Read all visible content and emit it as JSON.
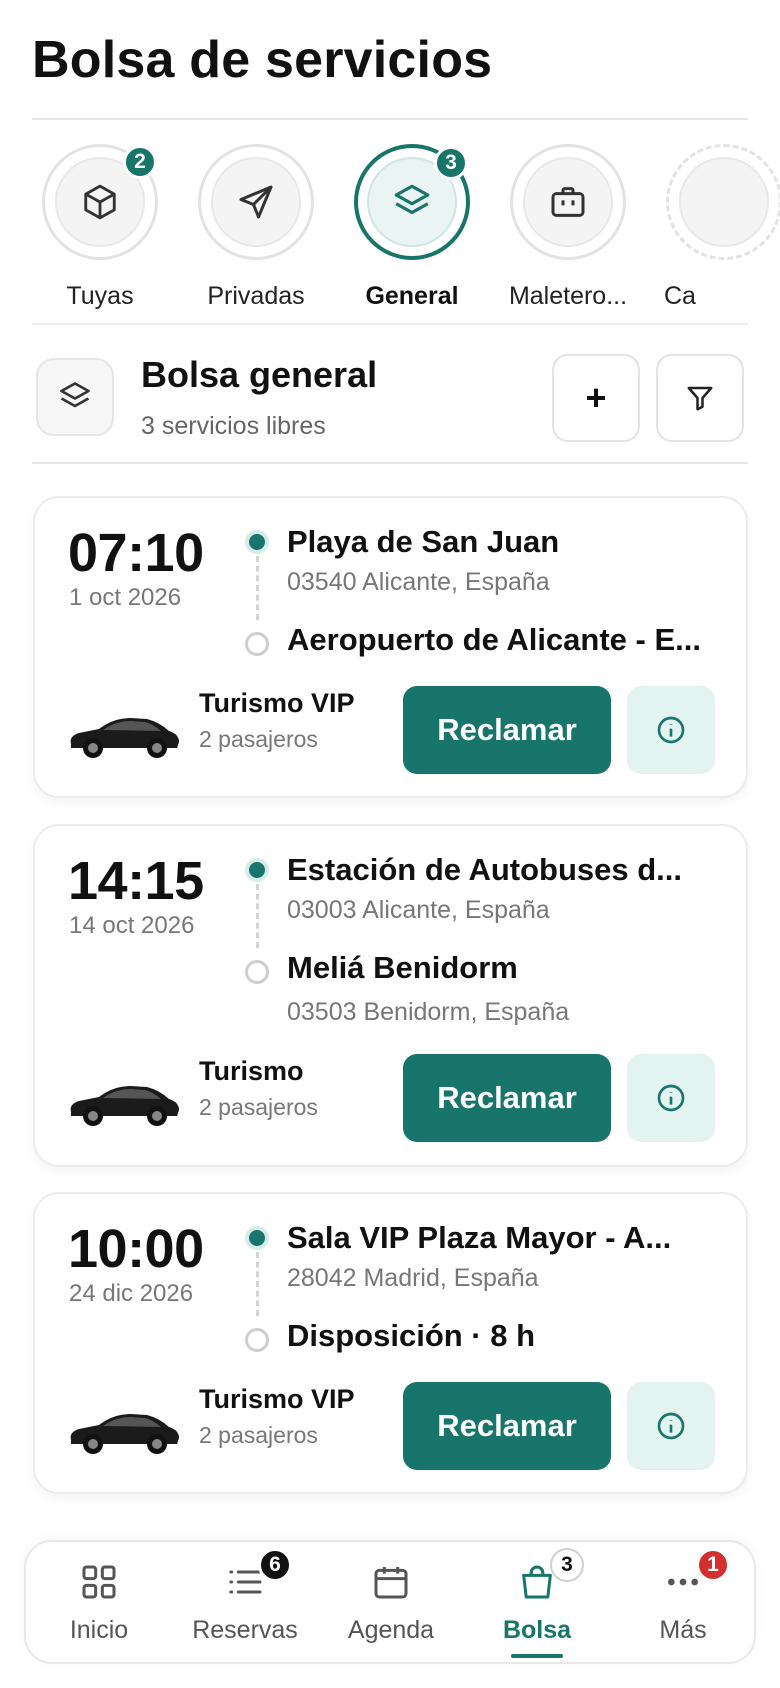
{
  "page": {
    "title": "Bolsa de servicios"
  },
  "categories": [
    {
      "label": "Tuyas",
      "icon": "box-icon",
      "badge": "2",
      "active": false
    },
    {
      "label": "Privadas",
      "icon": "send-icon",
      "badge": "",
      "active": false
    },
    {
      "label": "General",
      "icon": "layers-icon",
      "badge": "3",
      "active": true
    },
    {
      "label": "Maletero...",
      "icon": "briefcase-icon",
      "badge": "",
      "active": false
    },
    {
      "label": "Ca",
      "icon": "partial-icon",
      "badge": "",
      "active": false
    }
  ],
  "section": {
    "title": "Bolsa general",
    "subtitle": "3 servicios libres",
    "add_label": "+",
    "icon": "layers-icon"
  },
  "services": [
    {
      "time": "07:10",
      "date": "1 oct 2026",
      "from_name": "Playa de San Juan",
      "from_addr": "03540 Alicante, España",
      "to_name": "Aeropuerto de Alicante - E...",
      "to_addr": "",
      "vehicle": "Turismo VIP",
      "passengers": "2 pasajeros",
      "claim_label": "Reclamar"
    },
    {
      "time": "14:15",
      "date": "14 oct 2026",
      "from_name": "Estación de Autobuses d...",
      "from_addr": "03003 Alicante, España",
      "to_name": "Meliá Benidorm",
      "to_addr": "03503 Benidorm, España",
      "vehicle": "Turismo",
      "passengers": "2 pasajeros",
      "claim_label": "Reclamar"
    },
    {
      "time": "10:00",
      "date": "24 dic 2026",
      "from_name": "Sala VIP Plaza Mayor - A...",
      "from_addr": "28042 Madrid, España",
      "to_name": "Disposición · 8 h",
      "to_addr": "",
      "vehicle": "Turismo VIP",
      "passengers": "2 pasajeros",
      "claim_label": "Reclamar"
    }
  ],
  "nav": [
    {
      "label": "Inicio",
      "icon": "grid-icon",
      "badge": "",
      "active": false
    },
    {
      "label": "Reservas",
      "icon": "list-icon",
      "badge": "6",
      "active": false
    },
    {
      "label": "Agenda",
      "icon": "calendar-icon",
      "badge": "",
      "active": false
    },
    {
      "label": "Bolsa",
      "icon": "bag-icon",
      "badge": "3",
      "active": true
    },
    {
      "label": "Más",
      "icon": "more-icon",
      "badge": "1",
      "active": false
    }
  ],
  "colors": {
    "accent": "#17756b",
    "accent_light": "#e3f3f0",
    "alert": "#d32f2f"
  }
}
